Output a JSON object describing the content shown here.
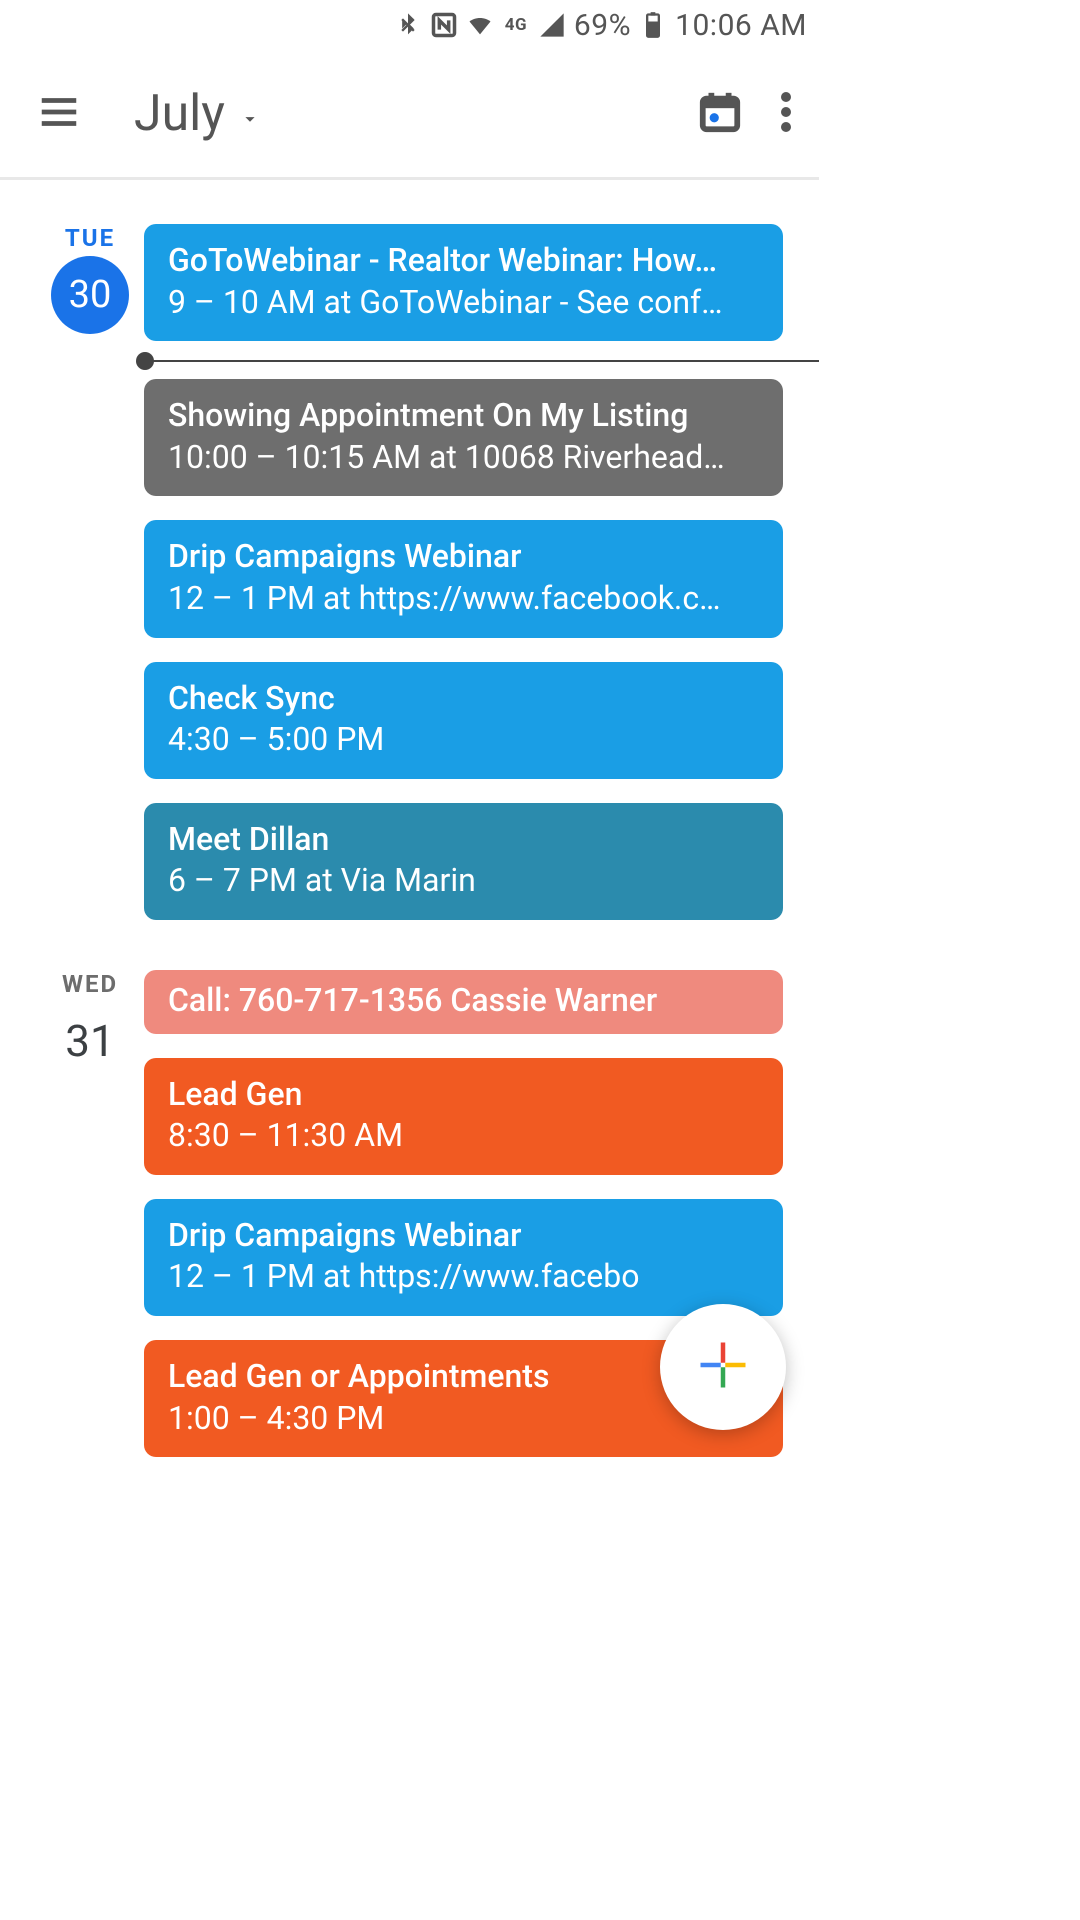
{
  "statusbar": {
    "battery_pct": "69%",
    "time": "10:06 AM",
    "lte_label": "4G",
    "icons": [
      "bluetooth",
      "nfc",
      "wifi",
      "lte",
      "signal",
      "battery"
    ]
  },
  "appbar": {
    "month": "July"
  },
  "colors": {
    "blue": "#1a9ee5",
    "grey": "#6e6e6e",
    "teal": "#2b8bad",
    "salmon": "#ef8a7e",
    "orange": "#f15a22"
  },
  "days": [
    {
      "dow": "TUE",
      "num": "30",
      "is_today": true,
      "events": [
        {
          "title": "GoToWebinar - Realtor Webinar: How…",
          "detail": "9 – 10 AM at GoToWebinar - See conf…",
          "color": "blue"
        },
        {
          "now_marker": true
        },
        {
          "title": "Showing Appointment On My Listing",
          "detail": "10:00 – 10:15 AM at 10068 Riverhead…",
          "color": "grey"
        },
        {
          "title": "Drip Campaigns Webinar",
          "detail": "12 – 1 PM at https://www.facebook.c…",
          "color": "blue"
        },
        {
          "title": "Check Sync",
          "detail": "4:30 – 5:00 PM",
          "color": "blue"
        },
        {
          "title": "Meet Dillan",
          "detail": "6 – 7 PM at Via Marin",
          "color": "teal"
        }
      ]
    },
    {
      "dow": "WED",
      "num": "31",
      "is_today": false,
      "events": [
        {
          "title": "Call: 760-717-1356 Cassie Warner",
          "detail": "",
          "color": "salmon",
          "small": true
        },
        {
          "title": "Lead Gen",
          "detail": "8:30 – 11:30 AM",
          "color": "orange"
        },
        {
          "title": "Drip Campaigns Webinar",
          "detail": "12 – 1 PM at https://www.facebo",
          "color": "blue"
        },
        {
          "title": "Lead Gen or Appointments",
          "detail": "1:00 – 4:30 PM",
          "color": "orange"
        }
      ]
    }
  ]
}
